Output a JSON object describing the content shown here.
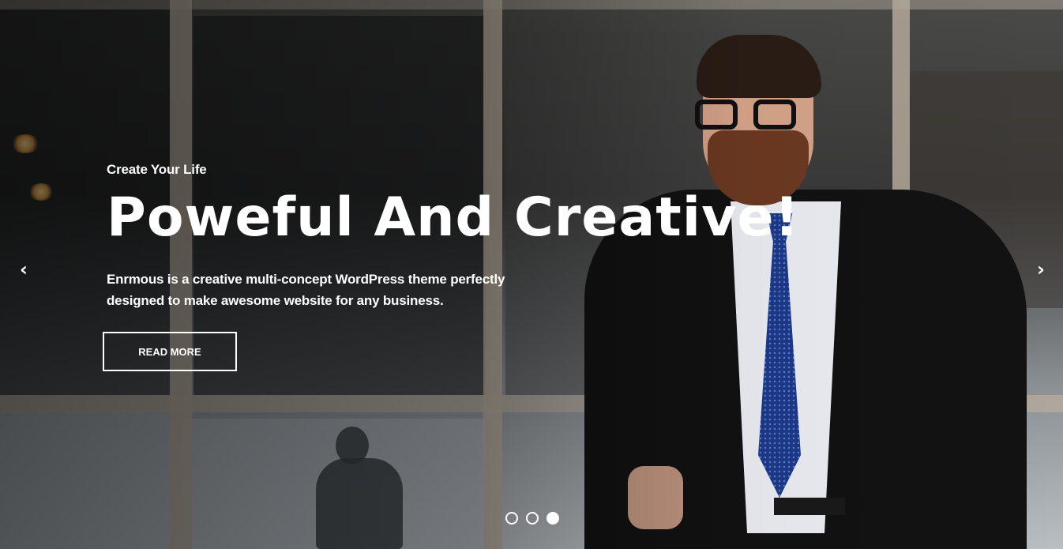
{
  "slide": {
    "subtitle": "Create Your Life",
    "title": "Poweful And Creative!",
    "description_line1": "Enrmous is a creative multi-concept WordPress theme perfectly",
    "description_line2": "designed to make awesome website for any business.",
    "button_label": "READ MORE"
  },
  "nav": {
    "prev_icon": "chevron-left-icon",
    "next_icon": "chevron-right-icon",
    "prev_glyph": "‹",
    "next_glyph": "›"
  },
  "pagination": {
    "total": 3,
    "active_index": 3
  },
  "colors": {
    "text": "#ffffff",
    "button_border": "#ffffff"
  }
}
